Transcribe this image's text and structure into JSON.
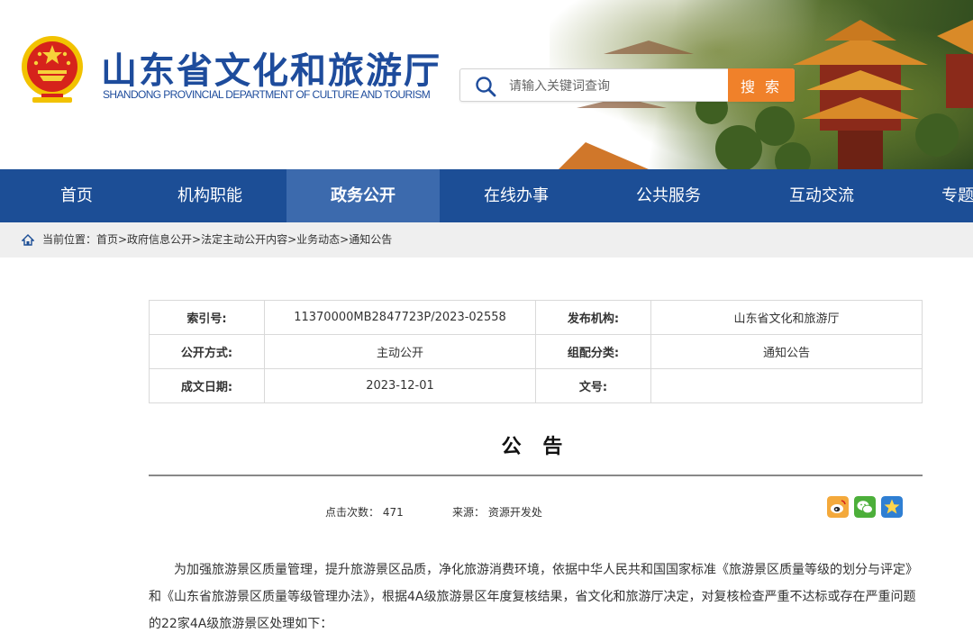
{
  "header": {
    "title_cn": "山东省文化和旅游厅",
    "title_en": "SHANDONG PROVINCIAL DEPARTMENT OF CULTURE AND TOURISM",
    "emblem": "national-emblem",
    "search": {
      "placeholder": "请输入关键词查询",
      "button_label": "搜 索",
      "icon": "search-icon"
    }
  },
  "nav": {
    "items": [
      {
        "label": "首页",
        "active": false
      },
      {
        "label": "机构职能",
        "active": false
      },
      {
        "label": "政务公开",
        "active": true
      },
      {
        "label": "在线办事",
        "active": false
      },
      {
        "label": "公共服务",
        "active": false
      },
      {
        "label": "互动交流",
        "active": false
      },
      {
        "label": "专题",
        "active": false
      }
    ]
  },
  "breadcrumb": {
    "icon": "home-icon",
    "text": "当前位置：首页>政府信息公开>法定主动公开内容>业务动态>通知公告"
  },
  "meta": {
    "rows": [
      [
        {
          "label": "索引号:",
          "value": "11370000MB2847723P/2023-02558"
        },
        {
          "label": "发布机构:",
          "value": "山东省文化和旅游厅"
        }
      ],
      [
        {
          "label": "公开方式:",
          "value": "主动公开"
        },
        {
          "label": "组配分类:",
          "value": "通知公告"
        }
      ],
      [
        {
          "label": "成文日期:",
          "value": "2023-12-01"
        },
        {
          "label": "文号:",
          "value": ""
        }
      ]
    ]
  },
  "article": {
    "title": "公 告",
    "clicks": "点击次数：  471",
    "source": "来源：  资源开发处",
    "share_icons": [
      "weibo-icon",
      "wechat-icon",
      "qzone-icon"
    ],
    "paragraph": "为加强旅游景区质量管理，提升旅游景区品质，净化旅游消费环境，依据中华人民共和国国家标准《旅游景区质量等级的划分与评定》和《山东省旅游景区质量等级管理办法》，根据4A级旅游景区年度复核结果，省文化和旅游厅决定，对复核检查严重不达标或存在严重问题的22家4A级旅游景区处理如下："
  },
  "colors": {
    "brand_blue": "#1c4e96",
    "nav_active": "#3c6aad",
    "search_button": "#f0812a",
    "title_blue": "#1e4c9c"
  }
}
